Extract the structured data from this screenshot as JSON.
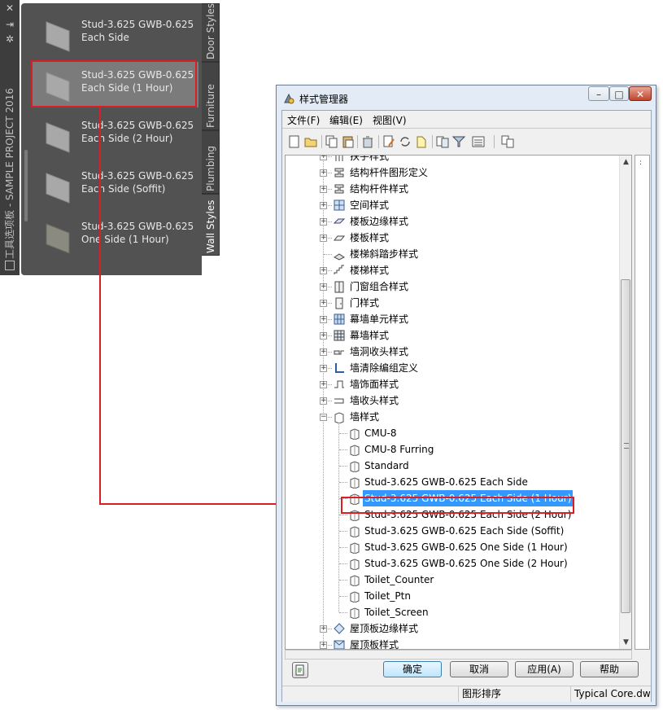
{
  "palette": {
    "title": "工具选项板 - SAMPLE PROJECT 2016",
    "controls": [
      "close-icon",
      "pin-icon",
      "properties-icon"
    ],
    "items": [
      {
        "label": "Stud-3.625 GWB-0.625 Each Side"
      },
      {
        "label": "Stud-3.625 GWB-0.625 Each Side (1 Hour)",
        "selected": true
      },
      {
        "label": "Stud-3.625 GWB-0.625 Each Side (2 Hour)"
      },
      {
        "label": "Stud-3.625 GWB-0.625 Each Side (Soffit)"
      },
      {
        "label": "Stud-3.625 GWB-0.625 One Side (1 Hour)"
      }
    ],
    "tabs": [
      {
        "label": "Door Styles"
      },
      {
        "label": "Furniture"
      },
      {
        "label": "Plumbing"
      },
      {
        "label": "Wall Styles",
        "active": true
      }
    ]
  },
  "window": {
    "title": "样式管理器",
    "controls": {
      "minimize": "–",
      "maximize": "□",
      "close": "✕"
    },
    "menu": [
      "文件(F)",
      "编辑(E)",
      "视图(V)"
    ],
    "toolbar_icons": [
      "new-icon",
      "open-icon",
      "copy-icon",
      "paste-icon",
      "purge-icon",
      "edit-style-icon",
      "synchronize-icon",
      "tag-icon",
      "filter-style-icon",
      "filter-icon",
      "view-list-icon",
      "toggle-view-icon"
    ],
    "tree": [
      {
        "label": "扶手样式",
        "level": 0,
        "icon": "railing-icon",
        "expander": "+"
      },
      {
        "label": "结构杆件图形定义",
        "level": 0,
        "icon": "member-shape-icon",
        "expander": "+"
      },
      {
        "label": "结构杆件样式",
        "level": 0,
        "icon": "member-style-icon",
        "expander": "+"
      },
      {
        "label": "空间样式",
        "level": 0,
        "icon": "space-icon",
        "expander": "+"
      },
      {
        "label": "楼板边缘样式",
        "level": 0,
        "icon": "slab-edge-icon",
        "expander": "+"
      },
      {
        "label": "楼板样式",
        "level": 0,
        "icon": "slab-icon",
        "expander": "+"
      },
      {
        "label": "楼梯斜踏步样式",
        "level": 0,
        "icon": "stair-winder-icon",
        "expander": ""
      },
      {
        "label": "楼梯样式",
        "level": 0,
        "icon": "stair-icon",
        "expander": "+"
      },
      {
        "label": "门窗组合样式",
        "level": 0,
        "icon": "door-window-assembly-icon",
        "expander": "+"
      },
      {
        "label": "门样式",
        "level": 0,
        "icon": "door-icon",
        "expander": "+"
      },
      {
        "label": "幕墙单元样式",
        "level": 0,
        "icon": "curtain-wall-unit-icon",
        "expander": "+"
      },
      {
        "label": "幕墙样式",
        "level": 0,
        "icon": "curtain-wall-icon",
        "expander": "+"
      },
      {
        "label": "墙洞收头样式",
        "level": 0,
        "icon": "wall-opening-endcap-icon",
        "expander": "+"
      },
      {
        "label": "墙清除编组定义",
        "level": 0,
        "icon": "wall-cleanup-icon",
        "expander": "+"
      },
      {
        "label": "墙饰面样式",
        "level": 0,
        "icon": "wall-modifier-icon",
        "expander": "+"
      },
      {
        "label": "墙收头样式",
        "level": 0,
        "icon": "wall-endcap-icon",
        "expander": "+"
      },
      {
        "label": "墙样式",
        "level": 0,
        "icon": "wall-style-icon",
        "expander": "−"
      },
      {
        "label": "CMU-8",
        "level": 1,
        "icon": "wall-icon",
        "expander": ""
      },
      {
        "label": "CMU-8 Furring",
        "level": 1,
        "icon": "wall-icon",
        "expander": ""
      },
      {
        "label": "Standard",
        "level": 1,
        "icon": "wall-icon",
        "expander": ""
      },
      {
        "label": "Stud-3.625 GWB-0.625 Each Side",
        "level": 1,
        "icon": "wall-icon",
        "expander": ""
      },
      {
        "label": "Stud-3.625 GWB-0.625 Each Side (1 Hour)",
        "level": 1,
        "icon": "wall-icon",
        "expander": "",
        "selected": true
      },
      {
        "label": "Stud-3.625 GWB-0.625 Each Side (2 Hour)",
        "level": 1,
        "icon": "wall-icon",
        "expander": ""
      },
      {
        "label": "Stud-3.625 GWB-0.625 Each Side (Soffit)",
        "level": 1,
        "icon": "wall-icon",
        "expander": ""
      },
      {
        "label": "Stud-3.625 GWB-0.625 One Side (1 Hour)",
        "level": 1,
        "icon": "wall-icon",
        "expander": ""
      },
      {
        "label": "Stud-3.625 GWB-0.625 One Side (2 Hour)",
        "level": 1,
        "icon": "wall-icon",
        "expander": ""
      },
      {
        "label": "Toilet_Counter",
        "level": 1,
        "icon": "wall-icon",
        "expander": ""
      },
      {
        "label": "Toilet_Ptn",
        "level": 1,
        "icon": "wall-icon",
        "expander": ""
      },
      {
        "label": "Toilet_Screen",
        "level": 1,
        "icon": "wall-icon",
        "expander": ""
      },
      {
        "label": "屋顶板边缘样式",
        "level": 0,
        "icon": "roof-slab-edge-icon",
        "expander": "+"
      },
      {
        "label": "屋顶板样式",
        "level": 0,
        "icon": "roof-slab-icon",
        "expander": "+"
      }
    ],
    "buttons": {
      "ok": "确定",
      "cancel": "取消",
      "apply": "应用(A)",
      "help": "帮助"
    },
    "status": {
      "sort": "图形排序",
      "drawing": "Typical Core.dwg"
    },
    "right_pane_mark": ":"
  },
  "colors": {
    "highlight": "#d91f26",
    "selection": "#3399ff",
    "palette_bg": "#525252"
  }
}
